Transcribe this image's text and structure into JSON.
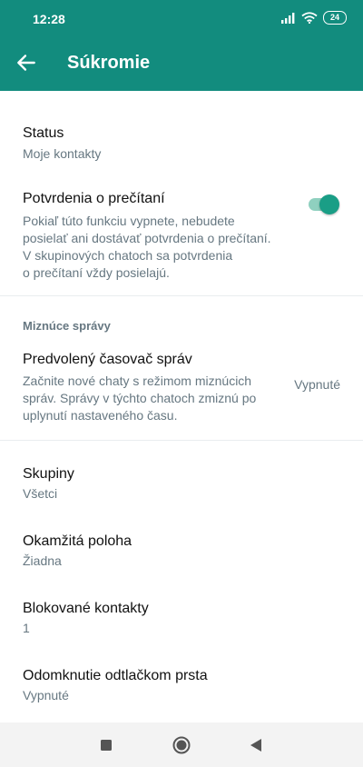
{
  "status_bar": {
    "time": "12:28",
    "battery": "24"
  },
  "header": {
    "title": "Súkromie"
  },
  "list": {
    "cutoff_text": "Všetci",
    "status": {
      "label": "Status",
      "value": "Moje kontakty"
    },
    "read_receipts": {
      "label": "Potvrdenia o prečítaní",
      "desc_lines": [
        "Pokiaľ túto funkciu vypnete, nebudete",
        "posielať ani dostávať potvrdenia o prečítaní.",
        "V skupinových chatoch sa potvrdenia",
        "o prečítaní vždy posielajú."
      ],
      "enabled": true
    },
    "disappearing_section": "Miznúce správy",
    "default_timer": {
      "label": "Predvolený časovač správ",
      "desc_lines": [
        "Začnite nové chaty s režimom miznúcich",
        "správ. Správy v týchto chatoch zmiznú po",
        "uplynutí nastaveného času."
      ],
      "value": "Vypnuté"
    },
    "groups": {
      "label": "Skupiny",
      "value": "Všetci"
    },
    "live_location": {
      "label": "Okamžitá poloha",
      "value": "Žiadna"
    },
    "blocked": {
      "label": "Blokované kontakty",
      "value": "1"
    },
    "fingerprint": {
      "label": "Odomknutie odtlačkom prsta",
      "value": "Vypnuté"
    }
  },
  "colors": {
    "primary": "#128c7e",
    "accent": "#1a9e86",
    "secondary_text": "#667781"
  },
  "icons": {
    "back": "arrow-back-icon",
    "signal": "signal-icon",
    "wifi": "wifi-icon",
    "battery": "battery-icon",
    "recents": "recents-square-icon",
    "home": "home-circle-icon",
    "back_nav": "back-triangle-icon"
  }
}
